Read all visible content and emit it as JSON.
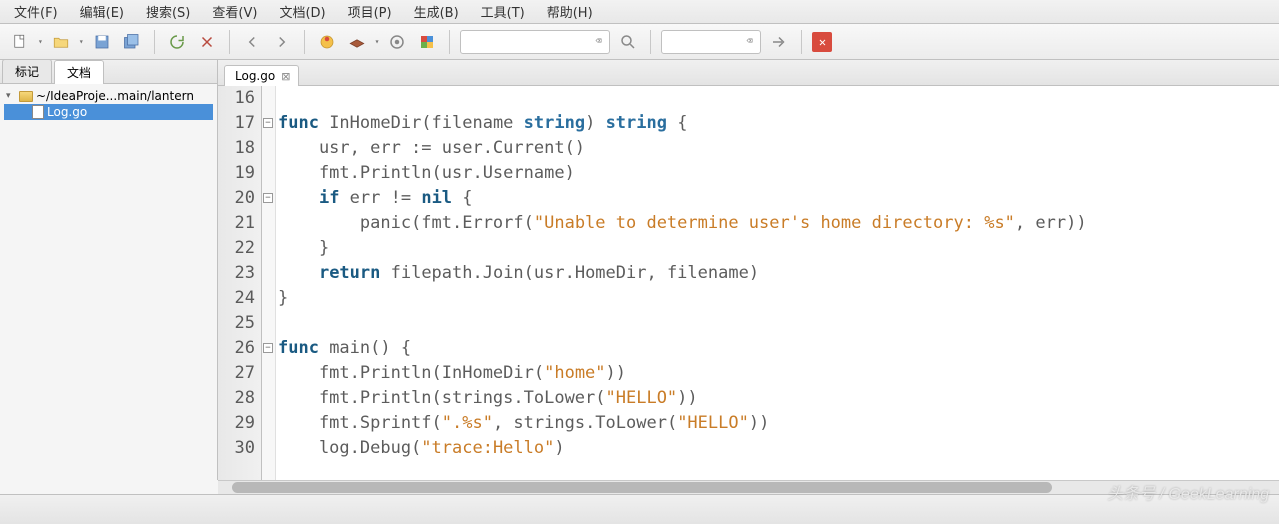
{
  "menu": {
    "items": [
      "文件(F)",
      "编辑(E)",
      "搜索(S)",
      "查看(V)",
      "文档(D)",
      "项目(P)",
      "生成(B)",
      "工具(T)",
      "帮助(H)"
    ]
  },
  "sidebar": {
    "tabs": {
      "marks": "标记",
      "docs": "文档"
    },
    "tree": {
      "root": "~/IdeaProje...main/lantern",
      "file": "Log.go"
    }
  },
  "editor": {
    "tab_label": "Log.go",
    "lines": [
      {
        "n": 16,
        "t": ""
      },
      {
        "n": 17,
        "t": "func InHomeDir(filename string) string {"
      },
      {
        "n": 18,
        "t": "    usr, err := user.Current()"
      },
      {
        "n": 19,
        "t": "    fmt.Println(usr.Username)"
      },
      {
        "n": 20,
        "t": "    if err != nil {"
      },
      {
        "n": 21,
        "t": "        panic(fmt.Errorf(\"Unable to determine user's home directory: %s\", err))"
      },
      {
        "n": 22,
        "t": "    }"
      },
      {
        "n": 23,
        "t": "    return filepath.Join(usr.HomeDir, filename)"
      },
      {
        "n": 24,
        "t": "}"
      },
      {
        "n": 25,
        "t": ""
      },
      {
        "n": 26,
        "t": "func main() {"
      },
      {
        "n": 27,
        "t": "    fmt.Println(InHomeDir(\"home\"))"
      },
      {
        "n": 28,
        "t": "    fmt.Println(strings.ToLower(\"HELLO\"))"
      },
      {
        "n": 29,
        "t": "    fmt.Sprintf(\".%s\", strings.ToLower(\"HELLO\"))"
      },
      {
        "n": 30,
        "t": "    log.Debug(\"trace:Hello\")"
      }
    ]
  },
  "watermark": "头条号 / GeekLearning"
}
